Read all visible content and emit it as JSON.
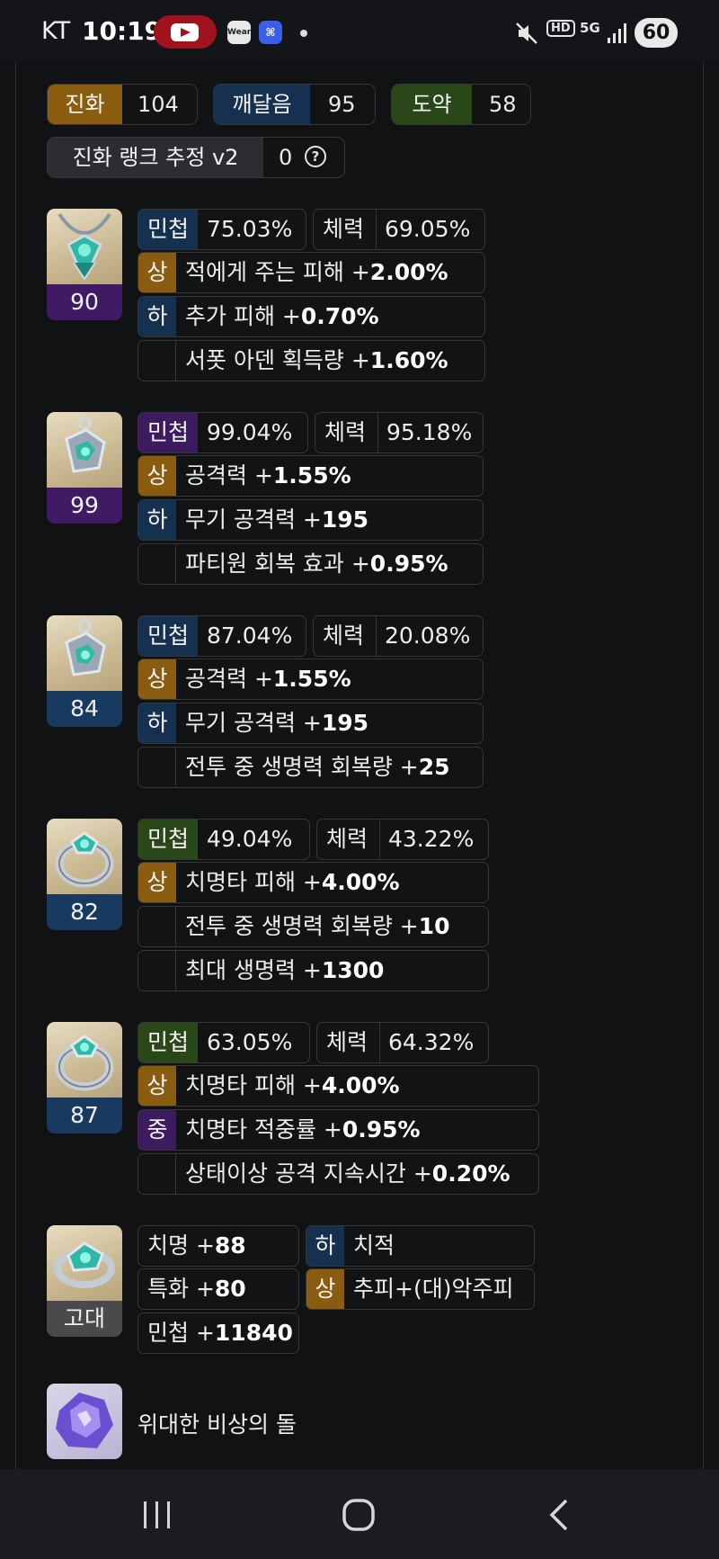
{
  "status_bar": {
    "carrier": "KT",
    "time": "10:19",
    "wear_label": "Wear",
    "hd_label": "HD",
    "network_label": "5G",
    "battery": "60"
  },
  "summary": {
    "jinhwa_label": "진화",
    "jinhwa_value": "104",
    "kkaedal_label": "깨달음",
    "kkaedal_value": "95",
    "doyak_label": "도약",
    "doyak_value": "58",
    "rank_label": "진화 랭크 추정 v2",
    "rank_value": "0"
  },
  "accessories": [
    {
      "level": "90",
      "stat1_label": "민첩",
      "stat1_value": "75.03%",
      "stat2_label": "체력",
      "stat2_value": "69.05%",
      "effects": [
        {
          "grade": "상",
          "name": "적에게 주는 피해 +",
          "value": "2.00%"
        },
        {
          "grade": "하",
          "name": "추가 피해 +",
          "value": "0.70%"
        },
        {
          "grade": "",
          "name": "서폿 아덴 획득량 +",
          "value": "1.60%"
        }
      ]
    },
    {
      "level": "99",
      "stat1_label": "민첩",
      "stat1_value": "99.04%",
      "stat2_label": "체력",
      "stat2_value": "95.18%",
      "effects": [
        {
          "grade": "상",
          "name": "공격력 +",
          "value": "1.55%"
        },
        {
          "grade": "하",
          "name": "무기 공격력 +",
          "value": "195"
        },
        {
          "grade": "",
          "name": "파티원 회복 효과 +",
          "value": "0.95%"
        }
      ]
    },
    {
      "level": "84",
      "stat1_label": "민첩",
      "stat1_value": "87.04%",
      "stat2_label": "체력",
      "stat2_value": "20.08%",
      "effects": [
        {
          "grade": "상",
          "name": "공격력 +",
          "value": "1.55%"
        },
        {
          "grade": "하",
          "name": "무기 공격력 +",
          "value": "195"
        },
        {
          "grade": "",
          "name": "전투 중 생명력 회복량 +",
          "value": "25"
        }
      ]
    },
    {
      "level": "82",
      "stat1_label": "민첩",
      "stat1_value": "49.04%",
      "stat2_label": "체력",
      "stat2_value": "43.22%",
      "effects": [
        {
          "grade": "상",
          "name": "치명타 피해 +",
          "value": "4.00%"
        },
        {
          "grade": "",
          "name": "전투 중 생명력 회복량 +",
          "value": "10"
        },
        {
          "grade": "",
          "name": "최대 생명력 +",
          "value": "1300"
        }
      ]
    },
    {
      "level": "87",
      "stat1_label": "민첩",
      "stat1_value": "63.05%",
      "stat2_label": "체력",
      "stat2_value": "64.32%",
      "effects": [
        {
          "grade": "상",
          "name": "치명타 피해 +",
          "value": "4.00%"
        },
        {
          "grade": "중",
          "name": "치명타 적중률 +",
          "value": "0.95%"
        },
        {
          "grade": "",
          "name": "상태이상 공격 지속시간 +",
          "value": "0.20%"
        }
      ]
    }
  ],
  "bracelet": {
    "grade_label": "고대",
    "crit_name": "치명 +",
    "crit_value": "88",
    "spec_name": "특화 +",
    "spec_value": "80",
    "dex_name": "민첩 +",
    "dex_value": "11840",
    "opt1_grade": "하",
    "opt1_text": "치적",
    "opt2_grade": "상",
    "opt2_text": "추피+(대)악주피"
  },
  "stone": {
    "name": "위대한 비상의 돌"
  },
  "colors": {
    "high": "#8a5c10",
    "low": "#15314f",
    "mid": "#3c1b5e",
    "green": "#2a4717",
    "lvl_purple": "#3f1b63",
    "lvl_blue": "#173a5e",
    "ancient": "#4a4a4d"
  }
}
